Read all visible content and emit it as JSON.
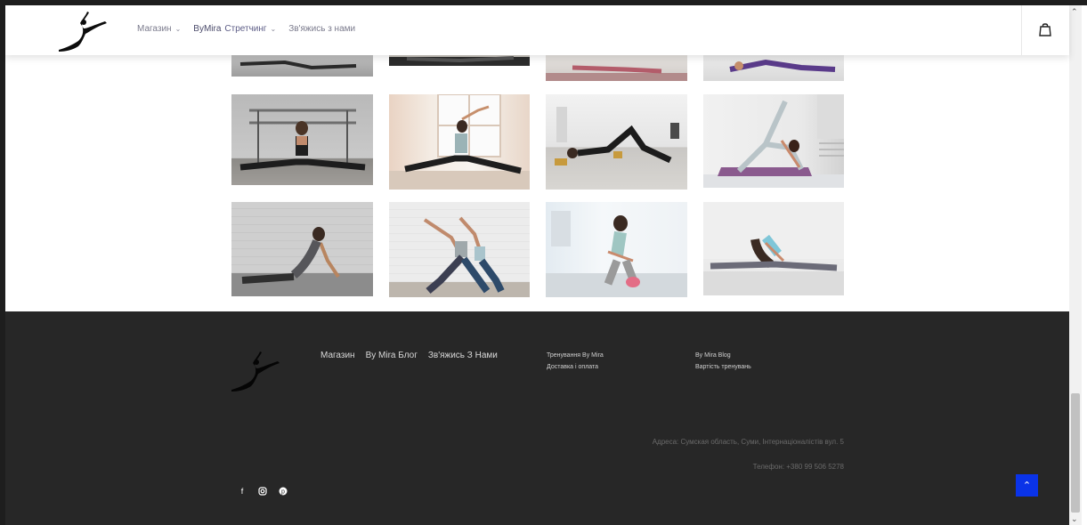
{
  "header": {
    "nav": [
      {
        "label": "Магазин",
        "has_dropdown": true
      },
      {
        "brand": "ByMira",
        "label": "Стретчинг",
        "has_dropdown": true
      },
      {
        "label": "Зв'яжись з нами",
        "has_dropdown": false
      }
    ],
    "cart_icon": "shopping-bag-icon"
  },
  "gallery": {
    "rows_visible": 3,
    "photos": [
      {
        "name": "stretch-photo-1"
      },
      {
        "name": "stretch-photo-2"
      },
      {
        "name": "stretch-photo-3"
      },
      {
        "name": "stretch-photo-4"
      },
      {
        "name": "barre-split-photo"
      },
      {
        "name": "window-split-photo"
      },
      {
        "name": "floor-stretch-blocks-photo"
      },
      {
        "name": "side-plank-mat-photo"
      },
      {
        "name": "cobra-pose-brick-photo"
      },
      {
        "name": "partner-yoga-photo"
      },
      {
        "name": "seated-forward-fold-photo"
      },
      {
        "name": "side-split-bend-photo"
      }
    ]
  },
  "footer": {
    "menu": [
      "Магазин",
      "By Mira Блог",
      "Зв'яжись З Нами"
    ],
    "col1": [
      "Тренування By Mira",
      "Доставка і оплата"
    ],
    "col2": [
      "By Mira Blog",
      "Вартість тренувань"
    ],
    "address": "Адреса: Сумская область, Суми, Інтернаціоналістів вул. 5",
    "phone": "Телефон: +380 99 506 5278",
    "social_icons": [
      "facebook-icon",
      "instagram-icon",
      "pinterest-icon"
    ],
    "back_to_top_icon": "chevron-up-icon",
    "accent_color": "#0a33e8",
    "background_color": "#272727"
  }
}
